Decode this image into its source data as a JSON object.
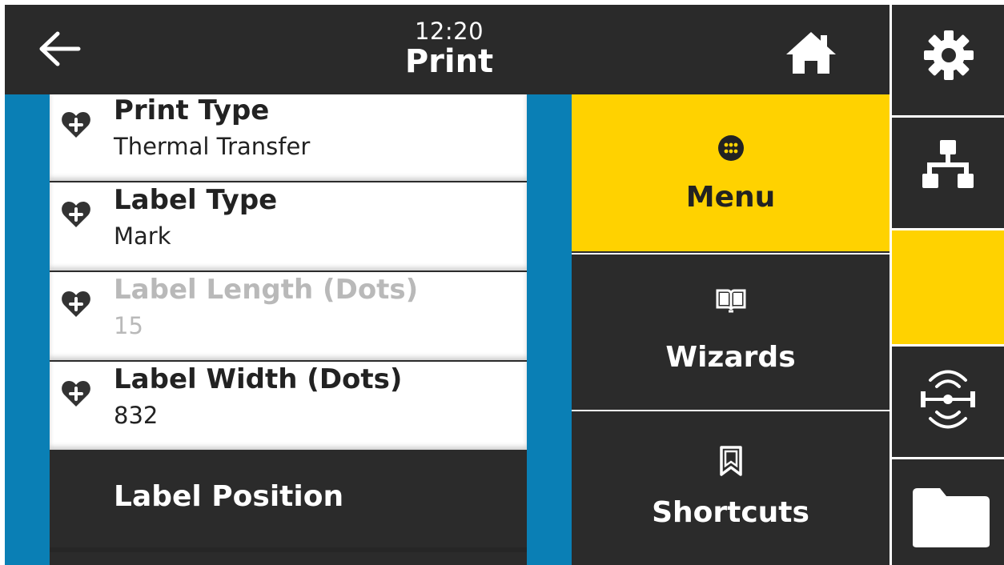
{
  "header": {
    "time": "12:20",
    "title": "Print",
    "back_icon": "arrow-left-icon",
    "home_icon": "home-icon"
  },
  "list": {
    "items": [
      {
        "label": "Print Type",
        "value": "Thermal Transfer",
        "icon": "heart-plus-icon",
        "enabled": true
      },
      {
        "label": "Label Type",
        "value": "Mark",
        "icon": "heart-plus-icon",
        "enabled": true
      },
      {
        "label": "Label Length (Dots)",
        "value": "15",
        "icon": "heart-plus-icon",
        "enabled": false
      },
      {
        "label": "Label Width (Dots)",
        "value": "832",
        "icon": "heart-plus-icon",
        "enabled": true
      }
    ],
    "next_item": {
      "label": "Label Position"
    }
  },
  "nav": {
    "menu": {
      "label": "Menu",
      "icon": "grid-circle-icon"
    },
    "wizards": {
      "label": "Wizards",
      "icon": "book-icon"
    },
    "shortcuts": {
      "label": "Shortcuts",
      "icon": "bookmark-icon"
    }
  },
  "sidebar": {
    "items": [
      {
        "name": "settings",
        "icon": "gear-icon"
      },
      {
        "name": "network",
        "icon": "network-icon"
      },
      {
        "name": "print",
        "icon": "none",
        "active": true
      },
      {
        "name": "rfid",
        "icon": "rfid-icon"
      },
      {
        "name": "storage",
        "icon": "folder-icon"
      }
    ]
  },
  "colors": {
    "accent_yellow": "#ffd200",
    "list_border_blue": "#0a7fb5",
    "dark_bg": "#2b2b2b",
    "disabled_text": "#b9b9b9"
  }
}
